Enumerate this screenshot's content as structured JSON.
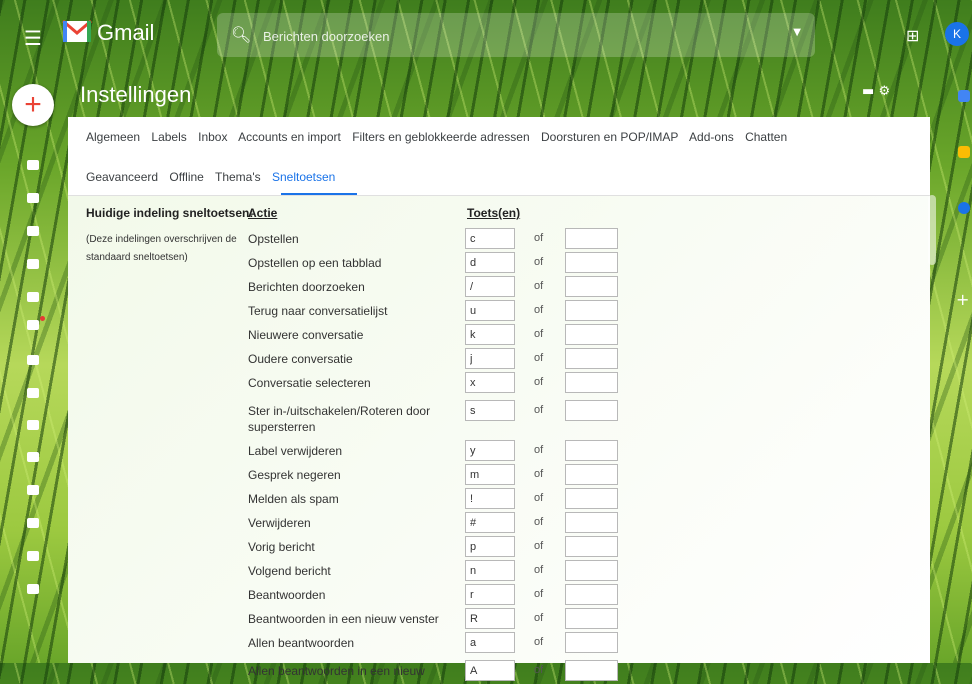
{
  "app": {
    "name": "Gmail"
  },
  "search": {
    "placeholder": "Berichten doorzoeken"
  },
  "avatar": {
    "initial": "K",
    "color": "#1a73e8"
  },
  "page": {
    "title": "Instellingen"
  },
  "tabs_row1": [
    "Algemeen",
    "Labels",
    "Inbox",
    "Accounts en import",
    "Filters en geblokkeerde adressen",
    "Doorsturen en POP/IMAP",
    "Add-ons",
    "Chatten"
  ],
  "tabs_row2": [
    "Geavanceerd",
    "Offline",
    "Thema's",
    "Sneltoetsen"
  ],
  "active_tab": "Sneltoetsen",
  "shortcuts": {
    "section_label": "Huidige indeling sneltoetsen:",
    "section_note": "(Deze indelingen overschrijven de standaard sneltoetsen)",
    "col_action": "Actie",
    "col_keys": "Toets(en)",
    "or_label": "of",
    "rows": [
      {
        "action": "Opstellen",
        "key": "c"
      },
      {
        "action": "Opstellen op een tabblad",
        "key": "d"
      },
      {
        "action": "Berichten doorzoeken",
        "key": "/"
      },
      {
        "action": "Terug naar conversatielijst",
        "key": "u"
      },
      {
        "action": "Nieuwere conversatie",
        "key": "k"
      },
      {
        "action": "Oudere conversatie",
        "key": "j"
      },
      {
        "action": "Conversatie selecteren",
        "key": "x"
      },
      {
        "action": "Ster in-/uitschakelen/Roteren door supersterren",
        "key": "s"
      },
      {
        "action": "Label verwijderen",
        "key": "y"
      },
      {
        "action": "Gesprek negeren",
        "key": "m"
      },
      {
        "action": "Melden als spam",
        "key": "!"
      },
      {
        "action": "Verwijderen",
        "key": "#"
      },
      {
        "action": "Vorig bericht",
        "key": "p"
      },
      {
        "action": "Volgend bericht",
        "key": "n"
      },
      {
        "action": "Beantwoorden",
        "key": "r"
      },
      {
        "action": "Beantwoorden in een nieuw venster",
        "key": "R"
      },
      {
        "action": "Allen beantwoorden",
        "key": "a"
      },
      {
        "action": "Allen beantwoorden in een nieuw",
        "key": "A"
      }
    ]
  },
  "colors": {
    "accent": "#1a73e8",
    "compose_plus": "#ea4335"
  }
}
